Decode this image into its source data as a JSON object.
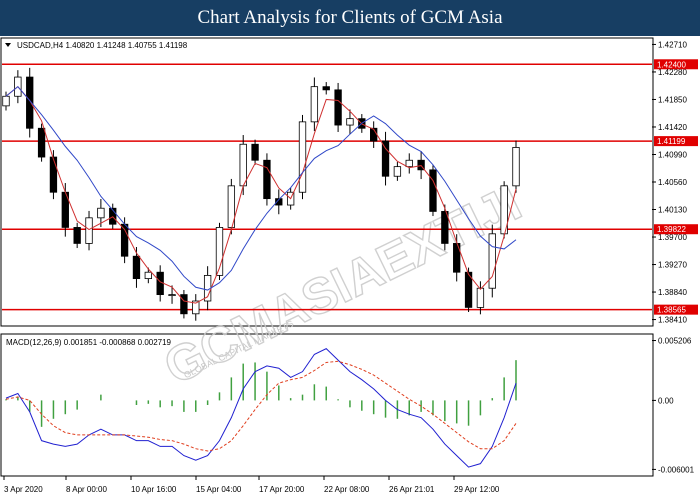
{
  "header": {
    "title": "Chart Analysis for Clients of GCM Asia"
  },
  "watermark": {
    "main": "GCMASIAEXTIJI",
    "sub": "GLOBAL CAPITAL MARKETS"
  },
  "chart_data": {
    "type": "candlestick",
    "symbol_info": "USDCAD,H4  1.40820 1.41248 1.40755 1.41198",
    "price_ticks": [
      "1.42710",
      "1.42280",
      "1.41850",
      "1.41420",
      "1.40990",
      "1.40560",
      "1.40130",
      "1.39700",
      "1.39270",
      "1.38840",
      "1.38410"
    ],
    "ylim": [
      1.38325,
      1.42795
    ],
    "x_labels": [
      "3 Apr 2020",
      "8 Apr 00:00",
      "10 Apr 16:00",
      "15 Apr 04:00",
      "17 Apr 20:00",
      "22 Apr 08:00",
      "26 Apr 21:01",
      "29 Apr 12:00"
    ],
    "levels": [
      {
        "value": 1.424,
        "label": "1.42400"
      },
      {
        "value": 1.41199,
        "label": "1.41199"
      },
      {
        "value": 1.39822,
        "label": "1.39822"
      },
      {
        "value": 1.38565,
        "label": "1.38565"
      }
    ],
    "close": [
      1.419,
      1.422,
      1.414,
      1.4095,
      1.404,
      1.3985,
      1.396,
      1.4,
      1.4015,
      1.399,
      1.394,
      1.3905,
      1.3915,
      1.388,
      1.388,
      1.385,
      1.387,
      1.391,
      1.3985,
      1.405,
      1.4115,
      1.409,
      1.403,
      1.402,
      1.404,
      1.415,
      1.4205,
      1.42,
      1.4145,
      1.4155,
      1.414,
      1.412,
      1.4065,
      1.408,
      1.409,
      1.4075,
      1.401,
      1.396,
      1.3915,
      1.386,
      1.389,
      1.3975,
      1.405,
      1.411
    ],
    "macd": {
      "label": "MACD(12,26,9) 0.001851 -0.000868 0.002719",
      "ticks": [
        "0.005206",
        "0.00",
        "-0.006001"
      ],
      "ylim": [
        -0.0064,
        0.0056
      ],
      "line": [
        0.0002,
        0.0006,
        -0.001,
        -0.0035,
        -0.0038,
        -0.004,
        -0.0038,
        -0.003,
        -0.0025,
        -0.003,
        -0.003,
        -0.0035,
        -0.0035,
        -0.004,
        -0.004,
        -0.0048,
        -0.0052,
        -0.0048,
        -0.0035,
        -0.0015,
        0.001,
        0.0025,
        0.003,
        0.0028,
        0.002,
        0.0025,
        0.004,
        0.0045,
        0.0035,
        0.0025,
        0.0018,
        0.001,
        0.0,
        -0.0008,
        -0.0012,
        -0.0015,
        -0.0025,
        -0.0038,
        -0.0048,
        -0.0058,
        -0.0055,
        -0.004,
        -0.0015,
        0.0015
      ],
      "signal": [
        0.0001,
        0.0003,
        0.0,
        -0.0012,
        -0.0022,
        -0.0028,
        -0.003,
        -0.003,
        -0.003,
        -0.003,
        -0.003,
        -0.0031,
        -0.0032,
        -0.0034,
        -0.0035,
        -0.0038,
        -0.0042,
        -0.0044,
        -0.0042,
        -0.0035,
        -0.0022,
        -0.0008,
        0.0005,
        0.0015,
        0.0018,
        0.002,
        0.0026,
        0.0033,
        0.0034,
        0.0031,
        0.0027,
        0.0022,
        0.0015,
        0.0008,
        0.0001,
        -0.0005,
        -0.0012,
        -0.002,
        -0.0028,
        -0.0036,
        -0.0042,
        -0.0042,
        -0.0035,
        -0.002
      ]
    },
    "colors": {
      "ma_fast": "#d03030",
      "ma_slow": "#3048c8",
      "levels": "#e00000",
      "macd_line": "#2020d0",
      "macd_signal": "#e04020",
      "histogram": "#40a040",
      "label_bg": "#e00000"
    }
  }
}
